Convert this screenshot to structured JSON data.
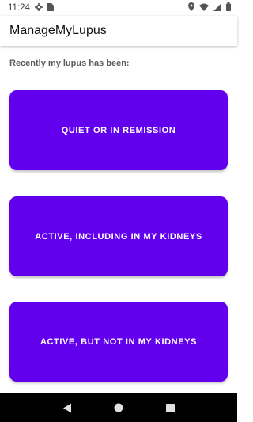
{
  "status_bar": {
    "time": "11:24",
    "icons": [
      "gear-icon",
      "sim-card-icon",
      "location-icon",
      "wifi-icon",
      "cell-signal-icon",
      "battery-icon"
    ]
  },
  "app_bar": {
    "title": "ManageMyLupus"
  },
  "main": {
    "prompt": "Recently my lupus has been:",
    "choices": [
      {
        "label": "QUIET OR IN REMISSION"
      },
      {
        "label": "ACTIVE, INCLUDING IN MY KIDNEYS"
      },
      {
        "label": "ACTIVE, BUT NOT IN MY KIDNEYS"
      }
    ],
    "button_color": "#6200ee"
  },
  "nav_bar": {
    "icons": [
      "back-icon",
      "home-icon",
      "recents-icon"
    ]
  }
}
